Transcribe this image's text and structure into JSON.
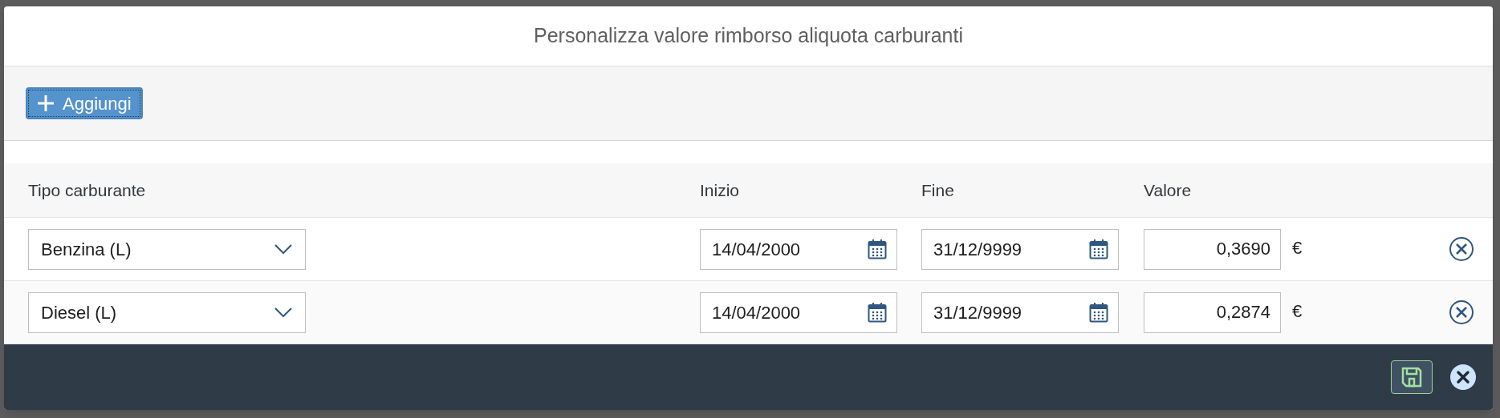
{
  "dialog": {
    "title": "Personalizza valore rimborso aliquota carburanti",
    "toolbar": {
      "add_button": "Aggiungi"
    },
    "table": {
      "columns": [
        "Tipo carburante",
        "Inizio",
        "Fine",
        "Valore"
      ],
      "rows": [
        {
          "fuel": "Benzina (L)",
          "start": "14/04/2000",
          "end": "31/12/9999",
          "value": "0,3690",
          "currency": "€"
        },
        {
          "fuel": "Diesel (L)",
          "start": "14/04/2000",
          "end": "31/12/9999",
          "value": "0,2874",
          "currency": "€"
        }
      ]
    }
  }
}
